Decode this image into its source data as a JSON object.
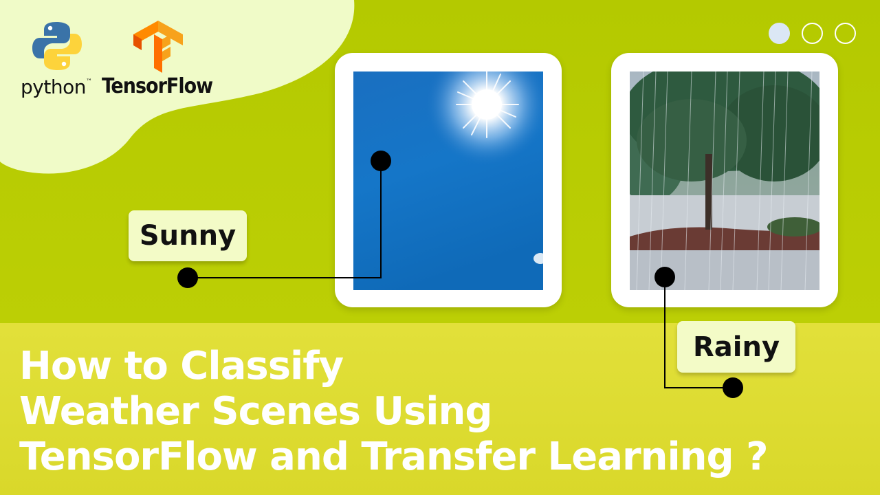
{
  "logos": {
    "python_text": "python",
    "python_tm": "™",
    "tensorflow_text": "TensorFlow",
    "python_icon": "python-icon",
    "tensorflow_icon": "tensorflow-icon"
  },
  "carousel": {
    "dot_count": 3,
    "active_index": 0
  },
  "images": [
    {
      "icon": "sunny-sky-image"
    },
    {
      "icon": "rainy-tree-image"
    }
  ],
  "labels": {
    "sunny": "Sunny",
    "rainy": "Rainy"
  },
  "headline": {
    "line1": "How to Classify",
    "line2": "Weather Scenes Using",
    "line3": "TensorFlow and Transfer Learning ?"
  },
  "colors": {
    "top_background": "#b4c900",
    "bottom_background": "#e2e03a",
    "blob": "#f0fbc8",
    "label_background": "#f3fbc7"
  }
}
